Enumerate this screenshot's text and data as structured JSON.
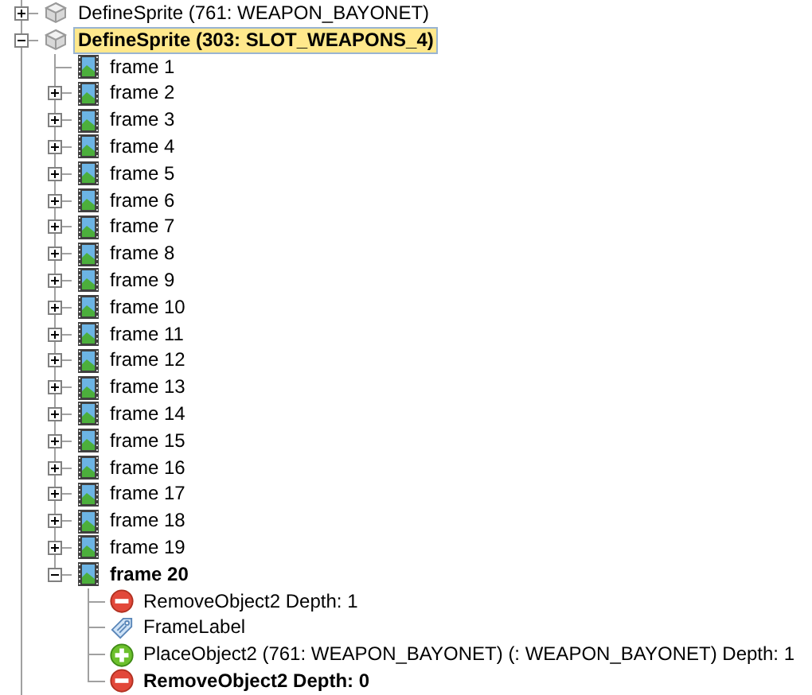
{
  "tree": {
    "continues_below": true,
    "items": [
      {
        "kind": "sprite",
        "label": "DefineSprite (761: WEAPON_BAYONET)",
        "bold": false,
        "selected": false,
        "expanded": false
      },
      {
        "kind": "sprite",
        "label": "DefineSprite (303: SLOT_WEAPONS_4)",
        "bold": true,
        "selected": true,
        "expanded": true,
        "children": [
          {
            "kind": "frame",
            "label": "frame 1",
            "bold": false,
            "selected": false
          },
          {
            "kind": "frame",
            "label": "frame 2",
            "bold": false,
            "selected": false,
            "expanded": false
          },
          {
            "kind": "frame",
            "label": "frame 3",
            "bold": false,
            "selected": false,
            "expanded": false
          },
          {
            "kind": "frame",
            "label": "frame 4",
            "bold": false,
            "selected": false,
            "expanded": false
          },
          {
            "kind": "frame",
            "label": "frame 5",
            "bold": false,
            "selected": false,
            "expanded": false
          },
          {
            "kind": "frame",
            "label": "frame 6",
            "bold": false,
            "selected": false,
            "expanded": false
          },
          {
            "kind": "frame",
            "label": "frame 7",
            "bold": false,
            "selected": false,
            "expanded": false
          },
          {
            "kind": "frame",
            "label": "frame 8",
            "bold": false,
            "selected": false,
            "expanded": false
          },
          {
            "kind": "frame",
            "label": "frame 9",
            "bold": false,
            "selected": false,
            "expanded": false
          },
          {
            "kind": "frame",
            "label": "frame 10",
            "bold": false,
            "selected": false,
            "expanded": false
          },
          {
            "kind": "frame",
            "label": "frame 11",
            "bold": false,
            "selected": false,
            "expanded": false
          },
          {
            "kind": "frame",
            "label": "frame 12",
            "bold": false,
            "selected": false,
            "expanded": false
          },
          {
            "kind": "frame",
            "label": "frame 13",
            "bold": false,
            "selected": false,
            "expanded": false
          },
          {
            "kind": "frame",
            "label": "frame 14",
            "bold": false,
            "selected": false,
            "expanded": false
          },
          {
            "kind": "frame",
            "label": "frame 15",
            "bold": false,
            "selected": false,
            "expanded": false
          },
          {
            "kind": "frame",
            "label": "frame 16",
            "bold": false,
            "selected": false,
            "expanded": false
          },
          {
            "kind": "frame",
            "label": "frame 17",
            "bold": false,
            "selected": false,
            "expanded": false
          },
          {
            "kind": "frame",
            "label": "frame 18",
            "bold": false,
            "selected": false,
            "expanded": false
          },
          {
            "kind": "frame",
            "label": "frame 19",
            "bold": false,
            "selected": false,
            "expanded": false
          },
          {
            "kind": "frame",
            "label": "frame 20",
            "bold": true,
            "selected": false,
            "expanded": true,
            "children": [
              {
                "kind": "remove",
                "label": "RemoveObject2 Depth: 1",
                "bold": false,
                "selected": false
              },
              {
                "kind": "label",
                "label": "FrameLabel",
                "bold": false,
                "selected": false
              },
              {
                "kind": "place",
                "label": "PlaceObject2 (761: WEAPON_BAYONET) (: WEAPON_BAYONET) Depth: 1",
                "bold": false,
                "selected": false
              },
              {
                "kind": "remove",
                "label": "RemoveObject2 Depth: 0",
                "bold": true,
                "selected": false
              }
            ]
          }
        ]
      }
    ]
  }
}
